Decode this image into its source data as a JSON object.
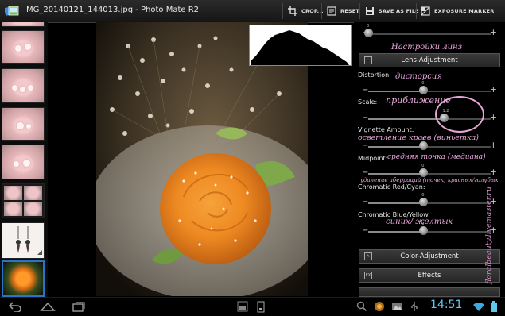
{
  "window": {
    "title": "IMG_20140121_144013.jpg - Photo Mate R2"
  },
  "toolbar": {
    "crop_label": "CROP...",
    "reset_label": "RESET",
    "save_as_file_label": "SAVE AS FILE",
    "exposure_marker_label": "EXPOSURE MARKER"
  },
  "lens_panel": {
    "annotation_title": "Настройки линз",
    "section_label": "Lens-Adjustment",
    "top_slider_value": "0",
    "distortion": {
      "label": "Distortion:",
      "annotation": "дисторсия",
      "value": "0",
      "fraction": 0.45
    },
    "scale": {
      "label": "Scale:",
      "annotation": "приближение",
      "value": "1.2",
      "fraction": 0.62
    },
    "vignette": {
      "label": "Vignette Amount:",
      "annotation": "осветление краев (виньетка)",
      "value": "0",
      "fraction": 0.45
    },
    "midpoint": {
      "label": "Midpoint:",
      "annotation": "средняя точка (медиана)",
      "value": "0",
      "fraction": 0.45
    },
    "chromatic_red": {
      "label": "Chromatic Red/Cyan:",
      "annotation": "удаление аберраций (точек) красных/голубых",
      "value": "0",
      "fraction": 0.45
    },
    "chromatic_blue": {
      "label": "Chromatic Blue/Yellow:",
      "annotation": "синих/ желтых",
      "value": "0",
      "fraction": 0.45
    }
  },
  "panel_buttons": {
    "color_adjustment": "Color-Adjustment",
    "effects": "Effects",
    "effects_icon_text": "FX"
  },
  "status": {
    "clock": "14:51"
  },
  "watermark": "floralbeauty.livemaster.ru",
  "colors": {
    "annotation": "#e9a8d9",
    "clock": "#5fc8f2",
    "selected_thumb_border": "#2a73c9"
  }
}
